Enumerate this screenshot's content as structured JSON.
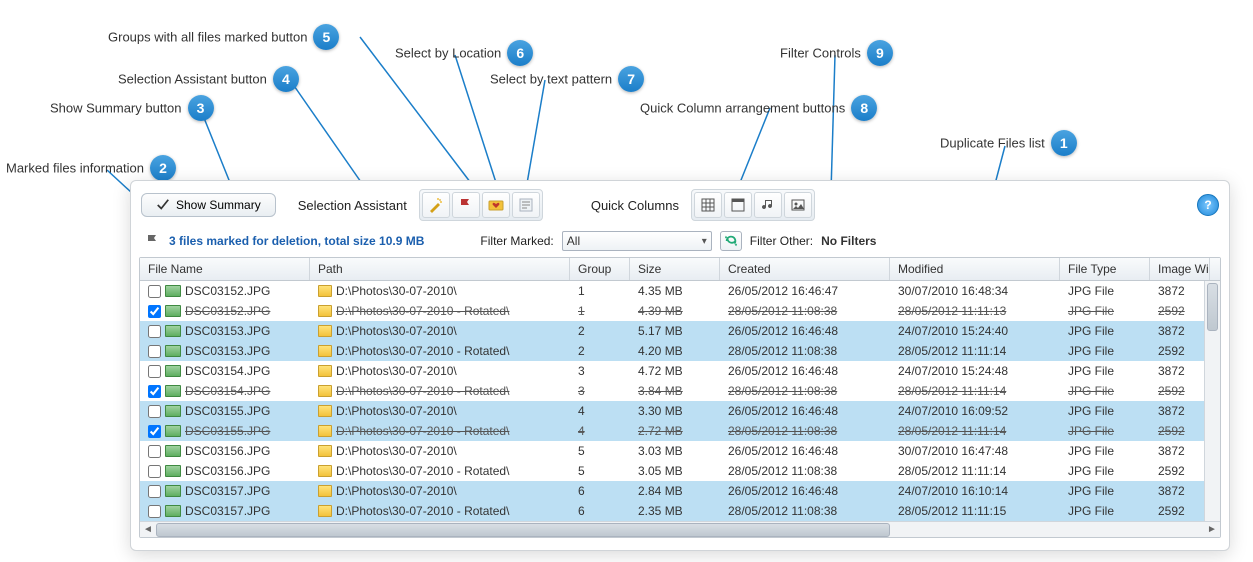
{
  "callouts": {
    "c1": "Duplicate Files list",
    "c2": "Marked files information",
    "c3": "Show Summary button",
    "c4": "Selection Assistant button",
    "c5": "Groups with all files marked button",
    "c6": "Select by Location",
    "c7": "Select by text pattern",
    "c8": "Quick Column arrangement buttons",
    "c9": "Filter Controls"
  },
  "toolbar": {
    "show_summary": "Show Summary",
    "selection_assistant": "Selection Assistant",
    "quick_columns": "Quick Columns",
    "help": "?"
  },
  "filter": {
    "marked_text": "3 files marked for deletion, total size 10.9 MB",
    "filter_marked_label": "Filter Marked:",
    "filter_marked_value": "All",
    "filter_other_label": "Filter Other:",
    "filter_other_value": "No Filters"
  },
  "columns": {
    "name": "File Name",
    "path": "Path",
    "group": "Group",
    "size": "Size",
    "created": "Created",
    "modified": "Modified",
    "type": "File Type",
    "iw": "Image Width"
  },
  "rows": [
    {
      "checked": false,
      "strike": false,
      "alt": 0,
      "name": "DSC03152.JPG",
      "path": "D:\\Photos\\30-07-2010\\",
      "group": "1",
      "size": "4.35 MB",
      "created": "26/05/2012 16:46:47",
      "modified": "30/07/2010 16:48:34",
      "type": "JPG File",
      "iw": "3872"
    },
    {
      "checked": true,
      "strike": true,
      "alt": 0,
      "name": "DSC03152.JPG",
      "path": "D:\\Photos\\30-07-2010 - Rotated\\",
      "group": "1",
      "size": "4.39 MB",
      "created": "28/05/2012 11:08:38",
      "modified": "28/05/2012 11:11:13",
      "type": "JPG File",
      "iw": "2592"
    },
    {
      "checked": false,
      "strike": false,
      "alt": 1,
      "name": "DSC03153.JPG",
      "path": "D:\\Photos\\30-07-2010\\",
      "group": "2",
      "size": "5.17 MB",
      "created": "26/05/2012 16:46:48",
      "modified": "24/07/2010 15:24:40",
      "type": "JPG File",
      "iw": "3872"
    },
    {
      "checked": false,
      "strike": false,
      "alt": 1,
      "name": "DSC03153.JPG",
      "path": "D:\\Photos\\30-07-2010 - Rotated\\",
      "group": "2",
      "size": "4.20 MB",
      "created": "28/05/2012 11:08:38",
      "modified": "28/05/2012 11:11:14",
      "type": "JPG File",
      "iw": "2592"
    },
    {
      "checked": false,
      "strike": false,
      "alt": 0,
      "name": "DSC03154.JPG",
      "path": "D:\\Photos\\30-07-2010\\",
      "group": "3",
      "size": "4.72 MB",
      "created": "26/05/2012 16:46:48",
      "modified": "24/07/2010 15:24:48",
      "type": "JPG File",
      "iw": "3872"
    },
    {
      "checked": true,
      "strike": true,
      "alt": 0,
      "name": "DSC03154.JPG",
      "path": "D:\\Photos\\30-07-2010 - Rotated\\",
      "group": "3",
      "size": "3.84 MB",
      "created": "28/05/2012 11:08:38",
      "modified": "28/05/2012 11:11:14",
      "type": "JPG File",
      "iw": "2592"
    },
    {
      "checked": false,
      "strike": false,
      "alt": 1,
      "name": "DSC03155.JPG",
      "path": "D:\\Photos\\30-07-2010\\",
      "group": "4",
      "size": "3.30 MB",
      "created": "26/05/2012 16:46:48",
      "modified": "24/07/2010 16:09:52",
      "type": "JPG File",
      "iw": "3872"
    },
    {
      "checked": true,
      "strike": true,
      "alt": 1,
      "name": "DSC03155.JPG",
      "path": "D:\\Photos\\30-07-2010 - Rotated\\",
      "group": "4",
      "size": "2.72 MB",
      "created": "28/05/2012 11:08:38",
      "modified": "28/05/2012 11:11:14",
      "type": "JPG File",
      "iw": "2592"
    },
    {
      "checked": false,
      "strike": false,
      "alt": 0,
      "name": "DSC03156.JPG",
      "path": "D:\\Photos\\30-07-2010\\",
      "group": "5",
      "size": "3.03 MB",
      "created": "26/05/2012 16:46:48",
      "modified": "30/07/2010 16:47:48",
      "type": "JPG File",
      "iw": "3872"
    },
    {
      "checked": false,
      "strike": false,
      "alt": 0,
      "name": "DSC03156.JPG",
      "path": "D:\\Photos\\30-07-2010 - Rotated\\",
      "group": "5",
      "size": "3.05 MB",
      "created": "28/05/2012 11:08:38",
      "modified": "28/05/2012 11:11:14",
      "type": "JPG File",
      "iw": "2592"
    },
    {
      "checked": false,
      "strike": false,
      "alt": 1,
      "name": "DSC03157.JPG",
      "path": "D:\\Photos\\30-07-2010\\",
      "group": "6",
      "size": "2.84 MB",
      "created": "26/05/2012 16:46:48",
      "modified": "24/07/2010 16:10:14",
      "type": "JPG File",
      "iw": "3872"
    },
    {
      "checked": false,
      "strike": false,
      "alt": 1,
      "name": "DSC03157.JPG",
      "path": "D:\\Photos\\30-07-2010 - Rotated\\",
      "group": "6",
      "size": "2.35 MB",
      "created": "28/05/2012 11:08:38",
      "modified": "28/05/2012 11:11:15",
      "type": "JPG File",
      "iw": "2592"
    }
  ]
}
